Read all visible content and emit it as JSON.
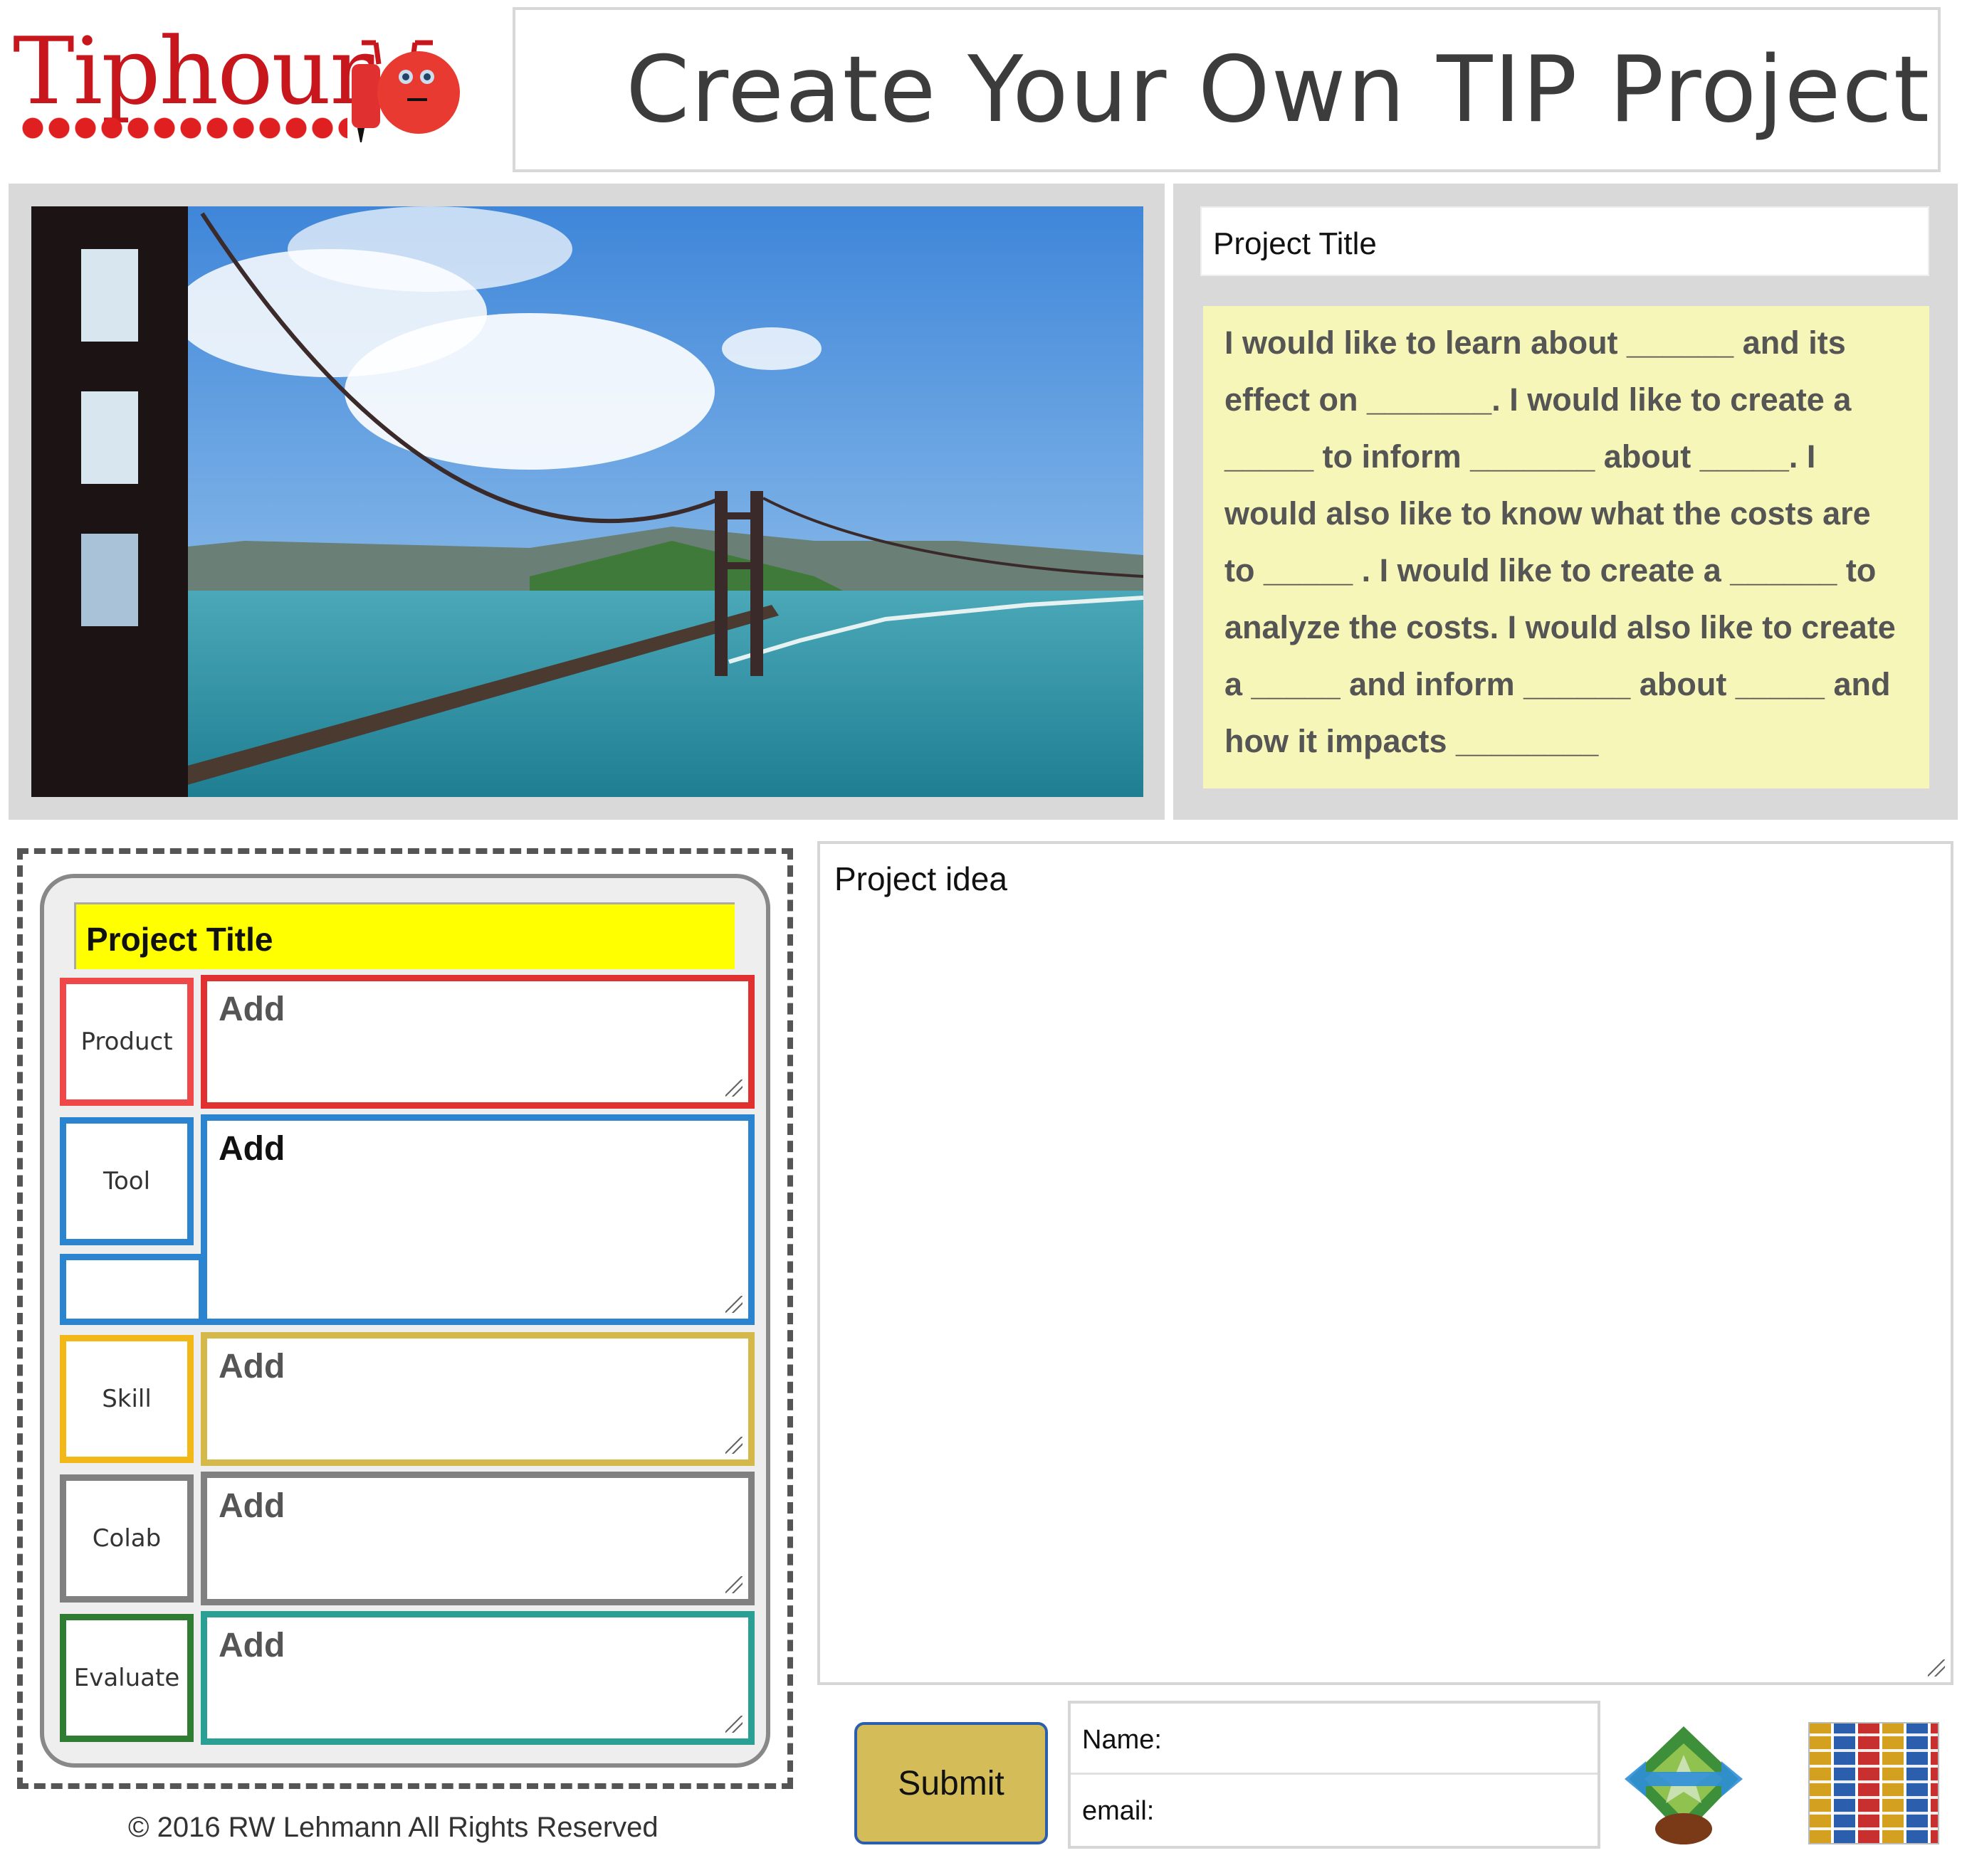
{
  "header": {
    "logo_text": "Tiphour",
    "title": "Create Your Own TIP Project"
  },
  "top": {
    "photo_alt": "Golden Gate Bridge",
    "project_title_placeholder": "Project Title",
    "template_text": "I would like to learn about ______ and its effect on _______. I would like to create a _____ to inform _______ about _____. I would also like to know what the costs are to _____ . I would like to create a ______ to analyze the costs. I would also like to create a _____ and inform ______ about _____ and how it impacts ________"
  },
  "planner": {
    "title": "Project Title",
    "rows": [
      {
        "label": "Product",
        "value": "Add",
        "color": "#e03030"
      },
      {
        "label": "Tool",
        "value": "Add",
        "color": "#2a84d0"
      },
      {
        "label": "Skill",
        "value": "Add",
        "color": "#d4b84a"
      },
      {
        "label": "Colab",
        "value": "Add",
        "color": "#808080"
      },
      {
        "label": "Evaluate",
        "value": "Add",
        "color": "#2f7d32",
        "text_color": "#2aa094"
      }
    ]
  },
  "copyright": "© 2016 RW Lehmann All Rights Reserved",
  "idea": {
    "placeholder": "Project idea"
  },
  "form": {
    "submit_label": "Submit",
    "name_label": "Name:",
    "email_label": "email:"
  },
  "icons": {
    "logo": "tiphour-logo-icon",
    "recycle": "recycle-badge-icon",
    "grid": "sticker-grid-icon"
  }
}
